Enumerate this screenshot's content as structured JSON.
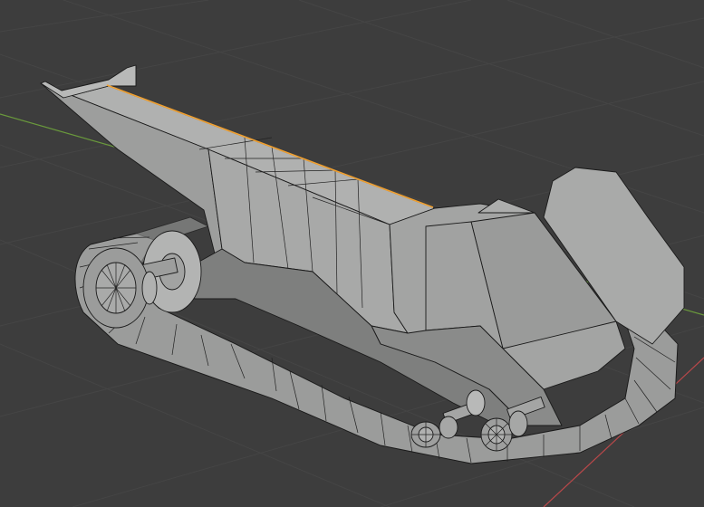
{
  "viewport": {
    "mode": "edit-mode-wireframe-overlay",
    "background_color": "#3d3d3d",
    "grid_color": "#454545",
    "x_axis_color": "#b8484a",
    "y_axis_color": "#6a9a3c",
    "selected_edge_color": "#f0a030",
    "mesh_light_color": "#a9aaa9",
    "mesh_mid_color": "#9c9d9c",
    "mesh_dark_color": "#7e7f7e",
    "wire_color": "#1a1a1a"
  },
  "model": {
    "name_icon": "tank-mesh",
    "parts": [
      "hull",
      "left-track",
      "front-drive-wheel",
      "rear-wheel-pair",
      "axle-shafts"
    ]
  }
}
